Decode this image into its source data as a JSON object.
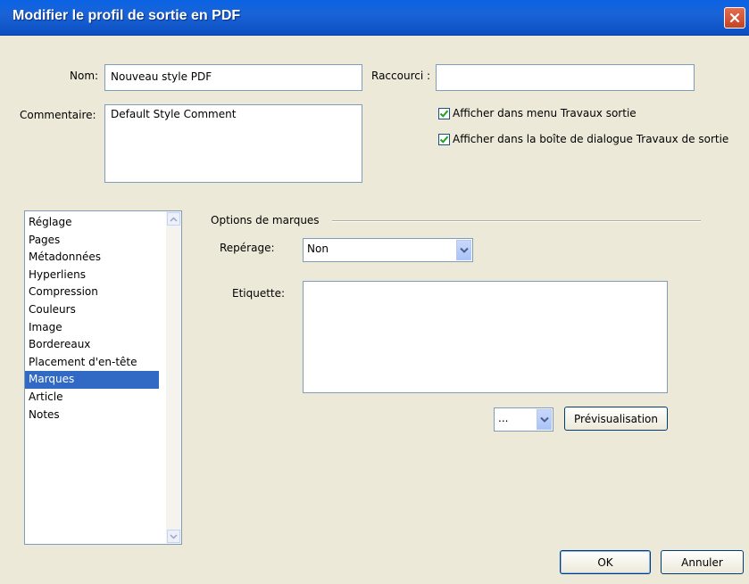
{
  "window": {
    "title": "Modifier le profil de sortie en PDF"
  },
  "form": {
    "name_label": "Nom:",
    "name_value": "Nouveau style PDF",
    "shortcut_label": "Raccourci :",
    "shortcut_value": "",
    "comment_label": "Commentaire:",
    "comment_value": "Default Style Comment",
    "checkbox_menu": {
      "label": "Afficher dans menu Travaux sortie",
      "checked": true
    },
    "checkbox_dialog": {
      "label": "Afficher dans la boîte de dialogue Travaux de sortie",
      "checked": true
    }
  },
  "sidebar": {
    "items": [
      {
        "label": "Réglage"
      },
      {
        "label": "Pages"
      },
      {
        "label": "Métadonnées"
      },
      {
        "label": "Hyperliens"
      },
      {
        "label": "Compression"
      },
      {
        "label": "Couleurs"
      },
      {
        "label": "Image"
      },
      {
        "label": "Bordereaux"
      },
      {
        "label": "Placement d'en-tête"
      },
      {
        "label": "Marques"
      },
      {
        "label": "Article"
      },
      {
        "label": "Notes"
      }
    ],
    "selected": "Marques"
  },
  "marks": {
    "group_label": "Options de marques",
    "registration_label": "Repérage:",
    "registration_value": "Non",
    "label_label": "Etiquette:",
    "label_value": "",
    "small_combo_value": "...",
    "preview_button": "Prévisualisation"
  },
  "footer": {
    "ok": "OK",
    "cancel": "Annuler"
  },
  "colors": {
    "title_bar": "#0a63e4",
    "selection": "#316ac5",
    "dialog_bg": "#ece9d8",
    "check": "#21a121"
  }
}
